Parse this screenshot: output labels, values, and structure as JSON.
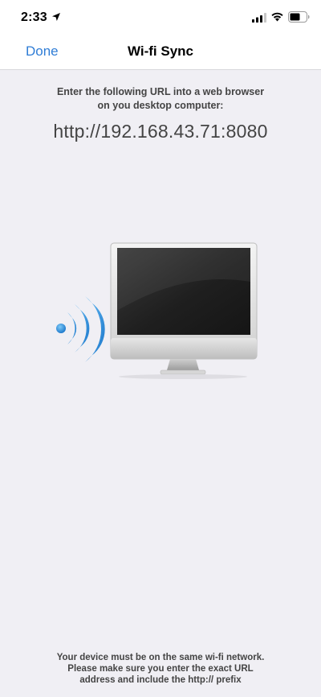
{
  "status_bar": {
    "time": "2:33",
    "icons": [
      "location-arrow-icon",
      "cellular-signal-icon",
      "wifi-icon",
      "battery-icon"
    ]
  },
  "nav": {
    "done_label": "Done",
    "title": "Wi-fi Sync"
  },
  "main": {
    "instruction_line1": "Enter the following URL into a web browser",
    "instruction_line2": "on you desktop computer:",
    "url": "http://192.168.43.71:8080"
  },
  "illustration": {
    "icons": [
      "wifi-waves-icon",
      "desktop-computer-icon"
    ],
    "colors": {
      "wave": "#2a8fe0",
      "screen": "#222222",
      "frame": "#d7d7d7"
    }
  },
  "footer": {
    "line1": "Your device must be on the same wi-fi network.",
    "line2": "Please make sure you enter the exact URL",
    "line3": "address and include the http:// prefix"
  },
  "colors": {
    "accent": "#2f7dd6",
    "background": "#f0eff4"
  }
}
